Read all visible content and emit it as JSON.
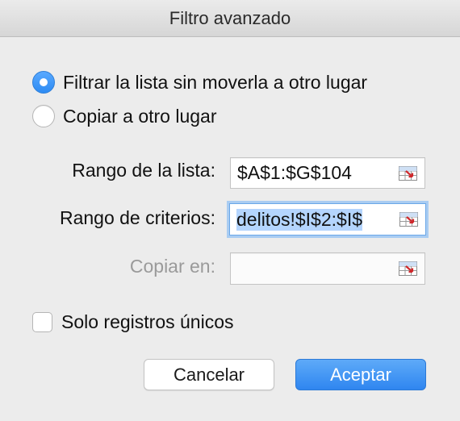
{
  "dialog": {
    "title": "Filtro avanzado"
  },
  "action": {
    "filter_in_place_label": "Filtrar la lista sin moverla a otro lugar",
    "filter_in_place_selected": true,
    "copy_to_location_label": "Copiar a otro lugar",
    "copy_to_location_selected": false
  },
  "fields": {
    "list_range": {
      "label": "Rango de la lista:",
      "value": "$A$1:$G$104"
    },
    "criteria_range": {
      "label": "Rango de criterios:",
      "value": "delitos!$I$2:$I$"
    },
    "copy_to": {
      "label": "Copiar en:",
      "value": "",
      "disabled": true
    }
  },
  "unique_records": {
    "label": "Solo registros únicos",
    "checked": false
  },
  "buttons": {
    "cancel": "Cancelar",
    "ok": "Aceptar"
  },
  "colors": {
    "accent": "#2f86f0",
    "focus_ring": "#a9ccf2",
    "selection": "#b4d5fe",
    "disabled_text": "#9a9a9a"
  },
  "icons": {
    "range_picker": "collapse-dialog-range-icon"
  }
}
